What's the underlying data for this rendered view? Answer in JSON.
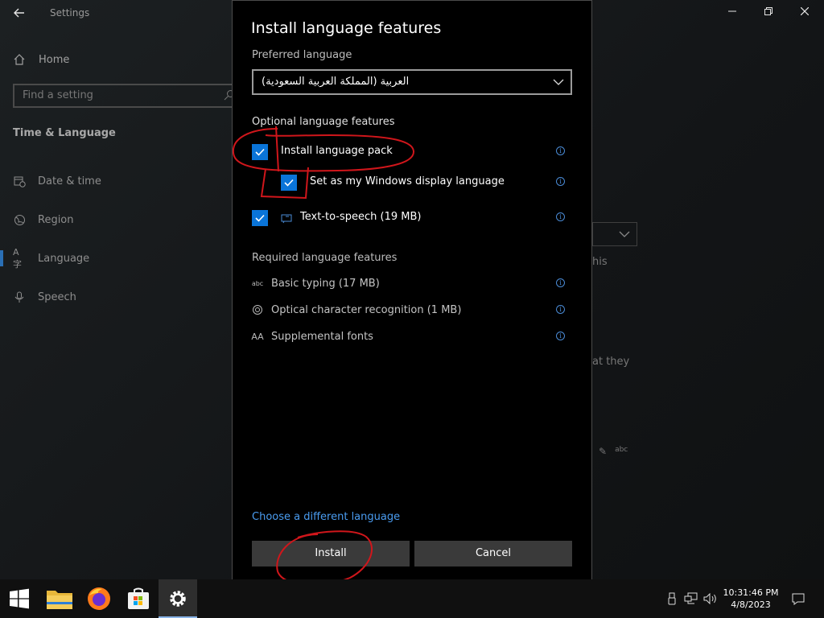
{
  "window": {
    "title": "Settings",
    "back_icon": "back-arrow-icon",
    "controls": [
      "minimize",
      "maximize",
      "close"
    ]
  },
  "sidebar": {
    "home_label": "Home",
    "search_placeholder": "Find a setting",
    "section_title": "Time & Language",
    "items": [
      {
        "label": "Date & time",
        "icon": "calendar-clock-icon"
      },
      {
        "label": "Region",
        "icon": "globe-icon"
      },
      {
        "label": "Language",
        "icon": "language-icon",
        "active": true
      },
      {
        "label": "Speech",
        "icon": "microphone-icon"
      }
    ]
  },
  "background": {
    "partial_text_1": "his",
    "partial_text_2": "at they"
  },
  "dialog": {
    "title": "Install language features",
    "preferred_language_label": "Preferred language",
    "preferred_language_value": "العربية (المملكة العربية السعودية)",
    "optional_heading": "Optional language features",
    "optional": [
      {
        "label": "Install language pack",
        "checked": true
      },
      {
        "label": "Set as my Windows display language",
        "checked": true
      },
      {
        "label": "Text-to-speech (19 MB)",
        "checked": true
      }
    ],
    "required_heading": "Required language features",
    "required": [
      {
        "label": "Basic typing (17 MB)",
        "icon": "abc-icon"
      },
      {
        "label": "Optical character recognition (1 MB)",
        "icon": "ocr-icon"
      },
      {
        "label": "Supplemental fonts",
        "icon": "font-icon"
      }
    ],
    "link_label": "Choose a different language",
    "install_label": "Install",
    "cancel_label": "Cancel"
  },
  "taskbar": {
    "apps": [
      "start",
      "file-explorer",
      "firefox",
      "microsoft-store",
      "settings"
    ],
    "time": "10:31:46 PM",
    "date": "4/8/2023"
  },
  "colors": {
    "accent": "#0a74d8",
    "link": "#4a9cf0",
    "annotation": "#d0161b"
  }
}
